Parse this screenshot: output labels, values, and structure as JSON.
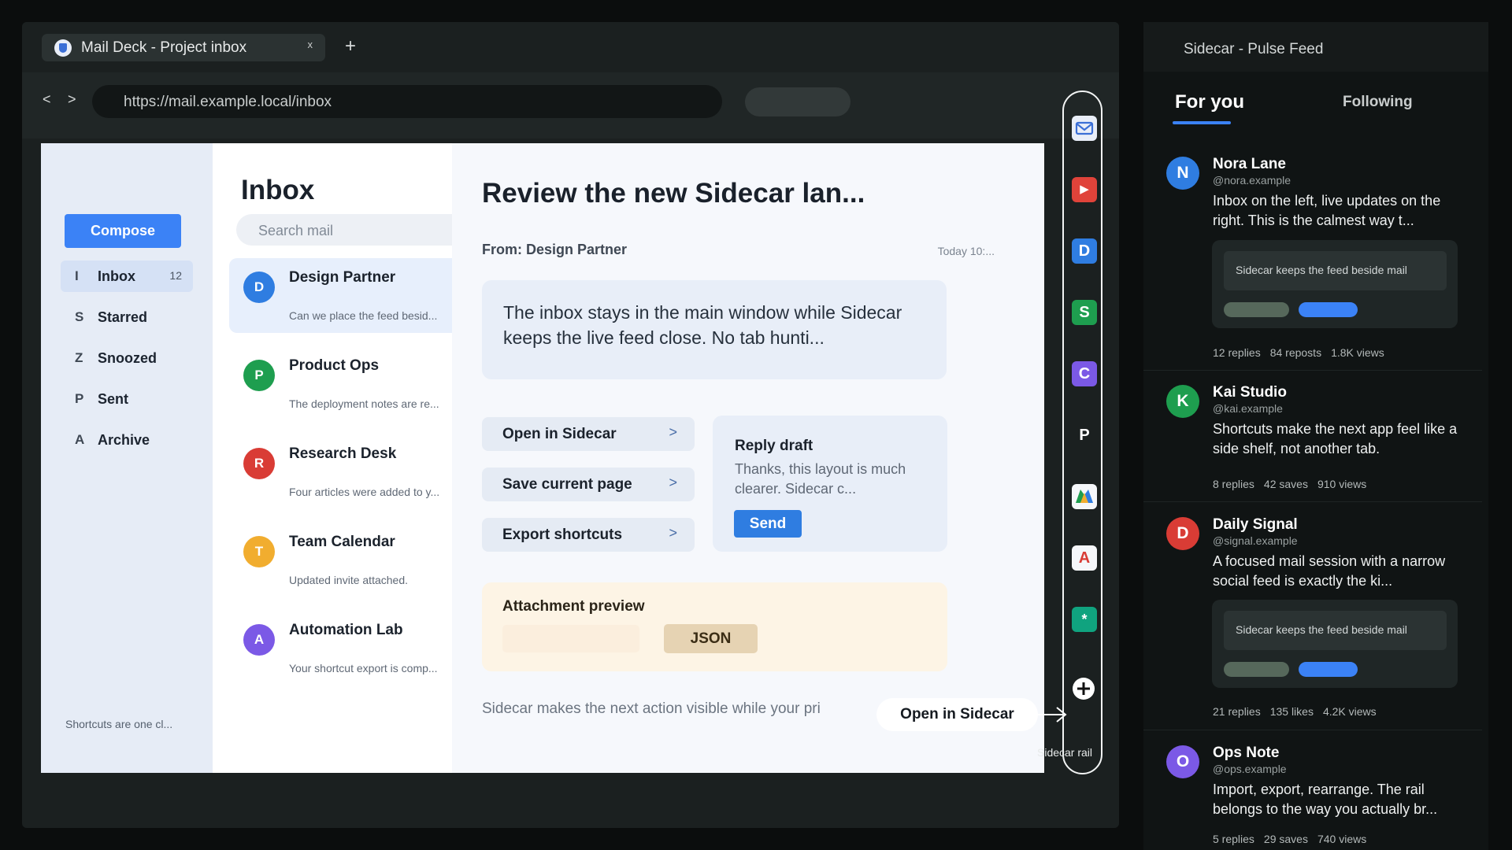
{
  "browser": {
    "tab_title": "Mail Deck - Project inbox",
    "tab_close": "x",
    "new_tab": "+",
    "back": "<",
    "forward": ">",
    "url": "https://mail.example.local/inbox"
  },
  "mail": {
    "compose": "Compose",
    "nav": [
      {
        "letter": "I",
        "label": "Inbox",
        "count": "12"
      },
      {
        "letter": "S",
        "label": "Starred",
        "count": ""
      },
      {
        "letter": "Z",
        "label": "Snoozed",
        "count": ""
      },
      {
        "letter": "P",
        "label": "Sent",
        "count": ""
      },
      {
        "letter": "A",
        "label": "Archive",
        "count": ""
      }
    ],
    "shortcuts_note": "Shortcuts are one cl...",
    "list_title": "Inbox",
    "search_placeholder": "Search mail",
    "messages": [
      {
        "initial": "D",
        "from": "Design Partner",
        "preview": "Can we place the feed besid...",
        "color": "#2f7de1"
      },
      {
        "initial": "P",
        "from": "Product Ops",
        "preview": "The deployment notes are re...",
        "color": "#1e9e4f"
      },
      {
        "initial": "R",
        "from": "Research Desk",
        "preview": "Four articles were added to y...",
        "color": "#d93c35"
      },
      {
        "initial": "T",
        "from": "Team Calendar",
        "preview": "Updated invite attached.",
        "color": "#f1ad2f"
      },
      {
        "initial": "A",
        "from": "Automation Lab",
        "preview": "Your shortcut export is comp...",
        "color": "#7b59e6"
      }
    ],
    "subject": "Review the new Sidecar lan...",
    "from_line": "From: Design Partner",
    "time": "Today 10:...",
    "body": "The inbox stays in the main window while Sidecar keeps the live feed close. No tab hunti...",
    "actions": [
      {
        "label": "Open in Sidecar",
        "chevron": ">"
      },
      {
        "label": "Save current page",
        "chevron": ">"
      },
      {
        "label": "Export shortcuts",
        "chevron": ">"
      }
    ],
    "reply_title": "Reply draft",
    "reply_text": "Thanks, this layout is much clearer. Sidecar c...",
    "send": "Send",
    "attachment_title": "Attachment preview",
    "json_button": "JSON",
    "footer_note": "Sidecar makes the next action visible while your pri"
  },
  "tooltip": "Open in Sidecar",
  "rail": {
    "label": "Sidecar rail",
    "icons": [
      {
        "name": "mail-icon",
        "glyph": "",
        "color": "#e9eef8"
      },
      {
        "name": "video-play-icon",
        "glyph": "▶",
        "color": "#e0433a"
      },
      {
        "name": "docs-d-icon",
        "glyph": "D",
        "color": "#2f7de1"
      },
      {
        "name": "sheets-s-icon",
        "glyph": "S",
        "color": "#1e9e4f"
      },
      {
        "name": "calendar-c-icon",
        "glyph": "C",
        "color": "#7b59e6"
      },
      {
        "name": "p-app-icon",
        "glyph": "P",
        "color": "transparent"
      },
      {
        "name": "drive-triangle-icon",
        "glyph": "",
        "color": "#f5f7fa"
      },
      {
        "name": "a-app-icon",
        "glyph": "A",
        "color": "#f5f7fa"
      },
      {
        "name": "asterisk-app-icon",
        "glyph": "*",
        "color": "#10a37f"
      }
    ],
    "add": "+"
  },
  "feed": {
    "header": "Sidecar - Pulse Feed",
    "tab_foryou": "For you",
    "tab_following": "Following",
    "embed_caption": "Sidecar keeps the feed beside mail",
    "posts": [
      {
        "initial": "N",
        "name": "Nora Lane",
        "handle": "@nora.example",
        "text": "Inbox on the left, live updates on the right. This is the calmest way t...",
        "color": "#2f7de1",
        "stats": [
          "12 replies",
          "84 reposts",
          "1.8K views"
        ]
      },
      {
        "initial": "K",
        "name": "Kai Studio",
        "handle": "@kai.example",
        "text": "Shortcuts make the next app feel like a side shelf, not another tab.",
        "color": "#1e9e4f",
        "stats": [
          "8 replies",
          "42 saves",
          "910 views"
        ]
      },
      {
        "initial": "D",
        "name": "Daily Signal",
        "handle": "@signal.example",
        "text": "A focused mail session with a narrow social feed is exactly the ki...",
        "color": "#d93c35",
        "stats": [
          "21 replies",
          "135 likes",
          "4.2K views"
        ]
      },
      {
        "initial": "O",
        "name": "Ops Note",
        "handle": "@ops.example",
        "text": "Import, export, rearrange. The rail belongs to the way you actually br...",
        "color": "#7b59e6",
        "stats": [
          "5 replies",
          "29 saves",
          "740 views"
        ]
      }
    ]
  }
}
